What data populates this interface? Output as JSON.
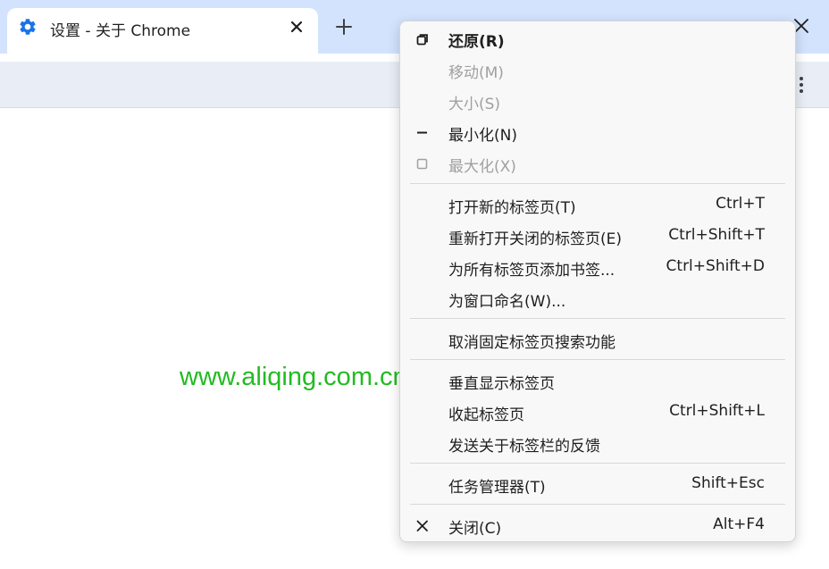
{
  "tab": {
    "title": "设置 - 关于 Chrome",
    "icon": "settings-gear-icon"
  },
  "watermark": "www.aliqing.com.cn",
  "menu": {
    "items": [
      {
        "label": "还原(R)",
        "shortcut": "",
        "icon": "restore-icon"
      },
      {
        "label": "移动(M)",
        "shortcut": ""
      },
      {
        "label": "大小(S)",
        "shortcut": ""
      },
      {
        "label": "最小化(N)",
        "shortcut": "",
        "icon": "minimize-icon"
      },
      {
        "label": "最大化(X)",
        "shortcut": "",
        "icon": "maximize-icon"
      },
      {
        "label": "打开新的标签页(T)",
        "shortcut": "Ctrl+T"
      },
      {
        "label": "重新打开关闭的标签页(E)",
        "shortcut": "Ctrl+Shift+T"
      },
      {
        "label": "为所有标签页添加书签...",
        "shortcut": "Ctrl+Shift+D"
      },
      {
        "label": "为窗口命名(W)...",
        "shortcut": ""
      },
      {
        "label": "取消固定标签页搜索功能",
        "shortcut": ""
      },
      {
        "label": "垂直显示标签页",
        "shortcut": ""
      },
      {
        "label": "收起标签页",
        "shortcut": "Ctrl+Shift+L"
      },
      {
        "label": "发送关于标签栏的反馈",
        "shortcut": ""
      },
      {
        "label": "任务管理器(T)",
        "shortcut": "Shift+Esc"
      },
      {
        "label": "关闭(C)",
        "shortcut": "Alt+F4",
        "icon": "close-icon"
      }
    ]
  },
  "colors": {
    "accent": "#1a73e8",
    "tabstrip": "#d3e3fd",
    "toolbar": "#e9eef6",
    "watermark": "#22bb22",
    "disabled_text": "#a0a0a0"
  }
}
